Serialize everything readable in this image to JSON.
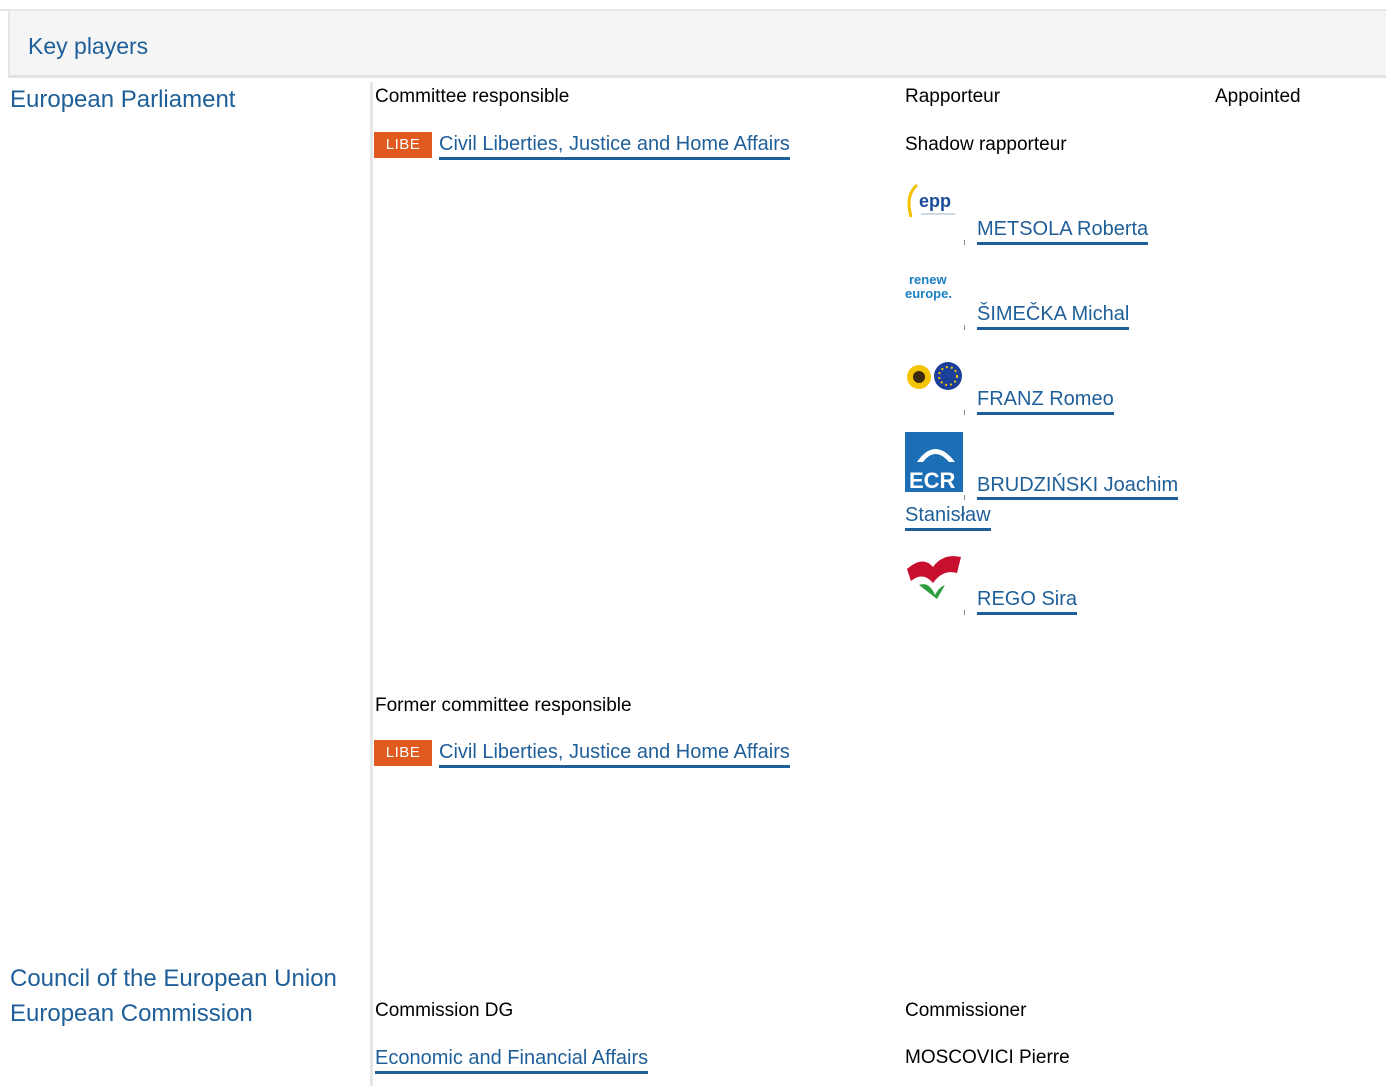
{
  "header": {
    "title": "Key players"
  },
  "left": {
    "parliament": "European Parliament",
    "council": "Council of the European Union",
    "commission": "European Commission"
  },
  "parliament": {
    "committee_responsible_label": "Committee responsible",
    "rapporteur_label": "Rapporteur",
    "appointed_label": "Appointed",
    "shadow_rapporteur_label": "Shadow rapporteur",
    "committee": {
      "badge": "LIBE",
      "name": "Civil Liberties, Justice and Home Affairs"
    },
    "shadow_rapporteurs": [
      {
        "name": "METSOLA Roberta",
        "group_logo": "epp-logo"
      },
      {
        "name": "ŠIMEČKA Michal",
        "group_logo": "renew-europe-logo"
      },
      {
        "name": "FRANZ Romeo",
        "group_logo": "greens-efa-logo"
      },
      {
        "name_line1": "BRUDZIŃSKI Joachim",
        "name_line2": "Stanisław",
        "group_logo": "ecr-logo"
      },
      {
        "name": "REGO Sira",
        "group_logo": "sd-logo"
      }
    ],
    "former_committee_label": "Former committee responsible",
    "former_committee": {
      "badge": "LIBE",
      "name": "Civil Liberties, Justice and Home Affairs"
    }
  },
  "commission": {
    "dg_label": "Commission DG",
    "commissioner_label": "Commissioner",
    "dg": "Economic and Financial Affairs",
    "commissioner": "MOSCOVICI Pierre"
  },
  "logo_text": {
    "epp": "epp",
    "renew_line1": "renew",
    "renew_line2": "europe.",
    "ecr": "ECR"
  },
  "colors": {
    "link": "#1f5f99",
    "badge": "#e05a20",
    "header_bg": "#f5f5f5",
    "border": "#e6e6e6"
  }
}
